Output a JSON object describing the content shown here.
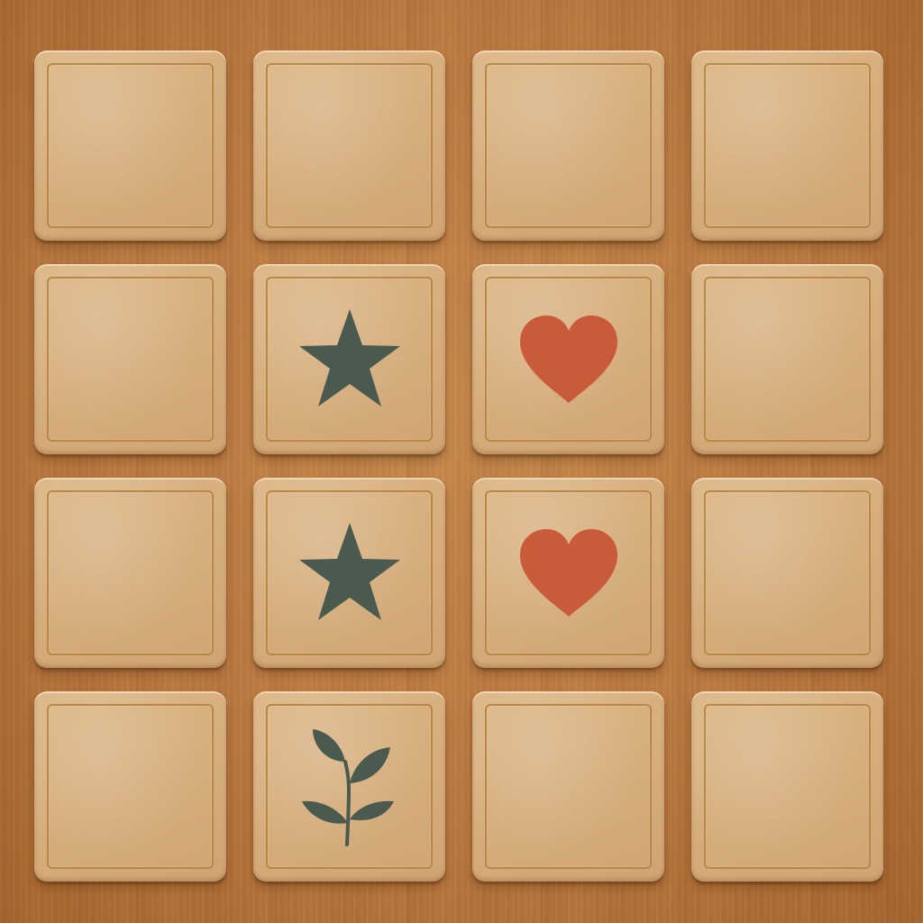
{
  "game": {
    "type": "memory-match",
    "rows": 4,
    "columns": 4
  },
  "colors": {
    "table_wood": "#bd7b40",
    "tile_face": "#d6ad7c",
    "tile_border": "#b98847",
    "star": "#4a5a4e",
    "heart": "#c95a3a",
    "plant": "#4a5a4e"
  },
  "tiles": [
    {
      "row": 1,
      "col": 1,
      "state": "face-down",
      "symbol": null
    },
    {
      "row": 1,
      "col": 2,
      "state": "face-down",
      "symbol": null
    },
    {
      "row": 1,
      "col": 3,
      "state": "face-down",
      "symbol": null
    },
    {
      "row": 1,
      "col": 4,
      "state": "face-down",
      "symbol": null
    },
    {
      "row": 2,
      "col": 1,
      "state": "face-down",
      "symbol": null
    },
    {
      "row": 2,
      "col": 2,
      "state": "face-up",
      "symbol": "star-icon"
    },
    {
      "row": 2,
      "col": 3,
      "state": "face-up",
      "symbol": "heart-icon"
    },
    {
      "row": 2,
      "col": 4,
      "state": "face-down",
      "symbol": null
    },
    {
      "row": 3,
      "col": 1,
      "state": "face-down",
      "symbol": null
    },
    {
      "row": 3,
      "col": 2,
      "state": "face-up",
      "symbol": "star-icon"
    },
    {
      "row": 3,
      "col": 3,
      "state": "face-up",
      "symbol": "heart-icon"
    },
    {
      "row": 3,
      "col": 4,
      "state": "face-down",
      "symbol": null
    },
    {
      "row": 4,
      "col": 1,
      "state": "face-down",
      "symbol": null
    },
    {
      "row": 4,
      "col": 2,
      "state": "face-up",
      "symbol": "plant-icon"
    },
    {
      "row": 4,
      "col": 3,
      "state": "face-down",
      "symbol": null
    },
    {
      "row": 4,
      "col": 4,
      "state": "face-down",
      "symbol": null
    }
  ]
}
